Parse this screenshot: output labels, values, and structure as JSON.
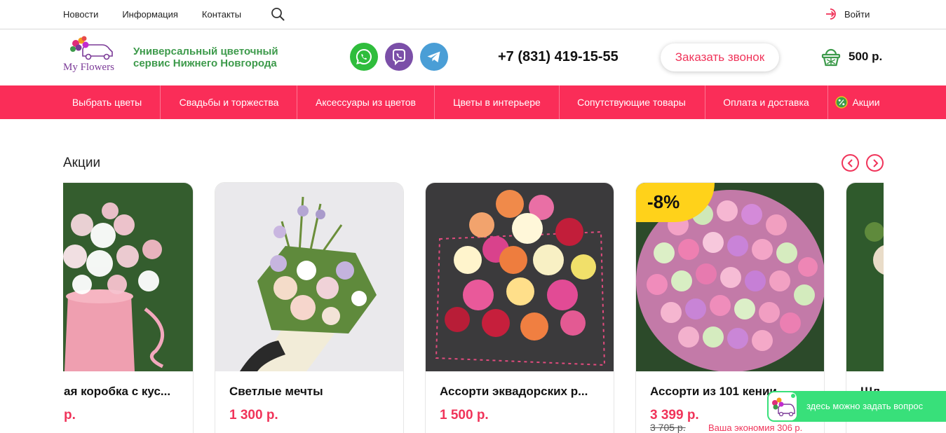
{
  "topbar": {
    "nav": [
      "Новости",
      "Информация",
      "Контакты"
    ],
    "login_label": "Войти"
  },
  "header": {
    "logo_text": "My Flowers",
    "tagline_line1": "Универсальный цветочный",
    "tagline_line2": "сервис Нижнего Новгорода",
    "messengers": [
      "whatsapp-icon",
      "viber-icon",
      "telegram-icon"
    ],
    "phone": "+7 (831) 419-15-55",
    "callback_label": "Заказать звонок",
    "cart_total": "500 р."
  },
  "mainnav": [
    "Выбрать цветы",
    "Свадьбы и торжества",
    "Аксессуары из цветов",
    "Цветы в интерьере",
    "Сопутствующие товары",
    "Оплата и доставка",
    "Акции"
  ],
  "promo": {
    "title": "Акции",
    "products": [
      {
        "name": "ая коробка с кус...",
        "price": "р."
      },
      {
        "name": "Светлые мечты",
        "price": "1 300 р."
      },
      {
        "name": "Ассорти эквадорских р...",
        "price": "1 500 р."
      },
      {
        "name": "Ассорти из 101 кении...",
        "price": "3 399 р.",
        "old_price": "3 705 р.",
        "saving": "Ваша экономия 306 р.",
        "badge": "-8%"
      },
      {
        "name": "Шл"
      }
    ]
  },
  "chat": {
    "label": "здесь можно задать вопрос"
  },
  "colors": {
    "accent": "#fa2d58",
    "price": "#f0345a",
    "tagline": "#3d9a4b",
    "chat": "#38e07a",
    "badge": "#ffd21a"
  }
}
